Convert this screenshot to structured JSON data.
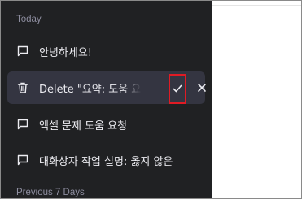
{
  "sidebar": {
    "sections": [
      {
        "label": "Today",
        "items": [
          {
            "label": "안녕하세요!"
          },
          {
            "label": "Delete \"요약: 도움 요청\"?",
            "editing": true
          },
          {
            "label": "엑셀 문제 도움 요청"
          },
          {
            "label": "대화상자 작업 설명: 옳지 않은"
          }
        ]
      },
      {
        "label": "Previous 7 Days",
        "items": []
      }
    ],
    "delete_confirm": {
      "confirm_icon": "check-icon",
      "cancel_icon": "close-icon"
    }
  },
  "colors": {
    "sidebar_bg": "#202123",
    "active_bg": "#343541",
    "highlight_border": "#e01b24",
    "section_label": "#8e8ea0"
  }
}
